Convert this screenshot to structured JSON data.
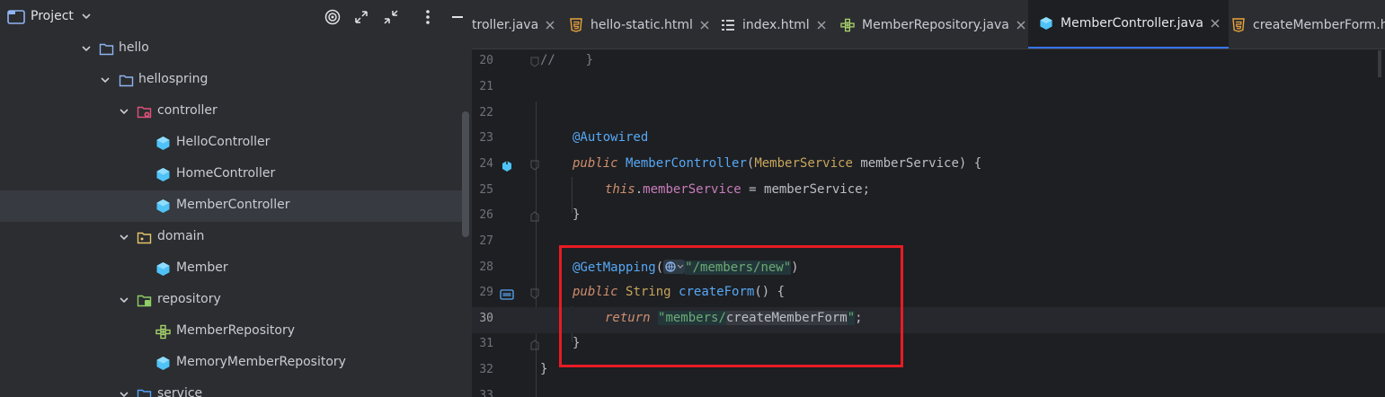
{
  "project": {
    "title": "Project"
  },
  "tree": [
    {
      "label": "hello",
      "icon": "folder-icon"
    },
    {
      "label": "hellospring",
      "icon": "folder-icon"
    },
    {
      "label": "controller",
      "icon": "controller-package-icon"
    },
    {
      "label": "HelloController",
      "icon": "class-icon"
    },
    {
      "label": "HomeController",
      "icon": "class-icon"
    },
    {
      "label": "MemberController",
      "icon": "class-icon"
    },
    {
      "label": "domain",
      "icon": "package-icon"
    },
    {
      "label": "Member",
      "icon": "class-icon"
    },
    {
      "label": "repository",
      "icon": "repository-package-icon"
    },
    {
      "label": "MemberRepository",
      "icon": "interface-icon"
    },
    {
      "label": "MemoryMemberRepository",
      "icon": "class-icon"
    },
    {
      "label": "service",
      "icon": "service-package-icon"
    }
  ],
  "tabs": [
    {
      "label": "troller.java",
      "icon": "java-icon"
    },
    {
      "label": "hello-static.html",
      "icon": "html-icon"
    },
    {
      "label": "index.html",
      "icon": "html-structure-icon"
    },
    {
      "label": "MemberRepository.java",
      "icon": "interface-icon"
    },
    {
      "label": "MemberController.java",
      "icon": "class-icon",
      "active": true
    },
    {
      "label": "createMemberForm.ht",
      "icon": "html-icon"
    }
  ],
  "code": {
    "lines": [
      {
        "no": "20",
        "parts": {
          "a": "//    }"
        }
      },
      {
        "no": "21"
      },
      {
        "no": "22"
      },
      {
        "no": "23",
        "parts": {
          "a": "@Autowired"
        }
      },
      {
        "no": "24",
        "parts": {
          "a": "public",
          "b": "MemberController",
          "c": "(",
          "d": "MemberService",
          "e": " memberService) {"
        }
      },
      {
        "no": "25",
        "parts": {
          "a": "this",
          "b": ".",
          "c": "memberService",
          "d": " = memberService;"
        }
      },
      {
        "no": "26",
        "parts": {
          "a": "}"
        }
      },
      {
        "no": "27"
      },
      {
        "no": "28",
        "parts": {
          "a": "@GetMapping",
          "b": "(",
          "c": "\"/members/new\"",
          "d": ")"
        }
      },
      {
        "no": "29",
        "parts": {
          "a": "public",
          "b": "String",
          "c": "createForm",
          "d": "() {"
        }
      },
      {
        "no": "30",
        "parts": {
          "a": "return",
          "b": "\"members/",
          "c": "createMemberForm",
          "d": "\"",
          "e": ";"
        }
      },
      {
        "no": "31",
        "parts": {
          "a": "}"
        }
      },
      {
        "no": "32",
        "parts": {
          "a": "}"
        }
      },
      {
        "no": "33"
      }
    ]
  },
  "colors": {
    "accent": "#3574f0",
    "highlight_border": "#e81b24"
  }
}
